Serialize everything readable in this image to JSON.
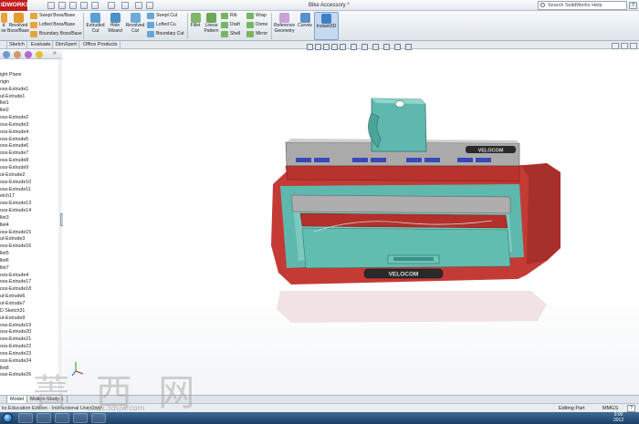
{
  "app": {
    "brand": "IDWORKS",
    "document_title": "Bike Accessory *",
    "search_placeholder": "Search SolidWorks Help",
    "help_label": "?"
  },
  "ribbon": {
    "commands": [
      {
        "id": "extrude",
        "label": "d\nse"
      },
      {
        "id": "revolved-boss",
        "label": "Revolved\nBoss/Base"
      },
      {
        "id": "extruded-cut",
        "label": "Extruded\nCut"
      },
      {
        "id": "hole-wizard",
        "label": "Hole\nWizard"
      },
      {
        "id": "revolved-cut",
        "label": "Revolved\nCut"
      },
      {
        "id": "fillet",
        "label": "Fillet"
      },
      {
        "id": "linear-pattern",
        "label": "Linear\nPattern"
      },
      {
        "id": "reference-geometry",
        "label": "Reference\nGeometry"
      },
      {
        "id": "curves",
        "label": "Curves"
      },
      {
        "id": "instant3d",
        "label": "Instant3D"
      }
    ],
    "stacked": {
      "swept_boss": "Swept Boss/Base",
      "lofted_boss": "Lofted Boss/Base",
      "boundary_boss": "Boundary Boss/Base",
      "swept_cut": "Swept Cut",
      "lofted_cut": "Lofted Cu",
      "boundary_cut": "Boundary Cut",
      "rib": "Rib",
      "draft": "Draft",
      "shell": "Shell",
      "wrap": "Wrap",
      "dome": "Dome",
      "mirror": "Mirror"
    }
  },
  "tabs": [
    "Sketch",
    "Evaluate",
    "DimXpert",
    "Office Products"
  ],
  "feature_tree": [
    "ight Plane",
    "rigin",
    "oss-Extrude1",
    "ut-Extrude1",
    "llet1",
    "llet2",
    "oss-Extrude2",
    "oss-Extrude3",
    "oss-Extrude4",
    "oss-Extrude5",
    "oss-Extrude6",
    "oss-Extrude7",
    "oss-Extrude8",
    "oss-Extrude9",
    "ut-Extrude2",
    "oss-Extrude10",
    "oss-Extrude11",
    "etch17",
    "oss-Extrude13",
    "oss-Extrude14",
    "llet3",
    "llet4",
    "oss-Extrude15",
    "ut-Extrude3",
    "oss-Extrude16",
    "llet5",
    "llet6",
    "llet7",
    "oss-Extrude4",
    "oss-Extrude17",
    "oss-Extrude18",
    "ut-Extrude6",
    "ut-Extrude7",
    "D Sketch31",
    "ut-Extrude9",
    "oss-Extrude19",
    "oss-Extrude20",
    "oss-Extrude21",
    "oss-Extrude22",
    "oss-Extrude23",
    "oss-Extrude24",
    "llet8",
    "oss-Extrude26"
  ],
  "model": {
    "front_logo": "VELOCOM",
    "top_logo": "VELOCOM"
  },
  "bottom_tabs": [
    "Model",
    "Motion Study 1"
  ],
  "status": {
    "left": "ks Education Edition - Instructional Use Only",
    "mode": "Editing Part",
    "units": "MMGS"
  },
  "taskbar": {
    "time": "9:00\n2012"
  },
  "watermark": {
    "chars": "菁 西 网",
    "url": "www.3dsjw.com"
  },
  "colors": {
    "body_red": "#c43a35",
    "body_red_dark": "#9b2420",
    "teal": "#5fb8ad",
    "grey_panel": "#a9a9a9",
    "window_blue": "#3b47b8"
  }
}
